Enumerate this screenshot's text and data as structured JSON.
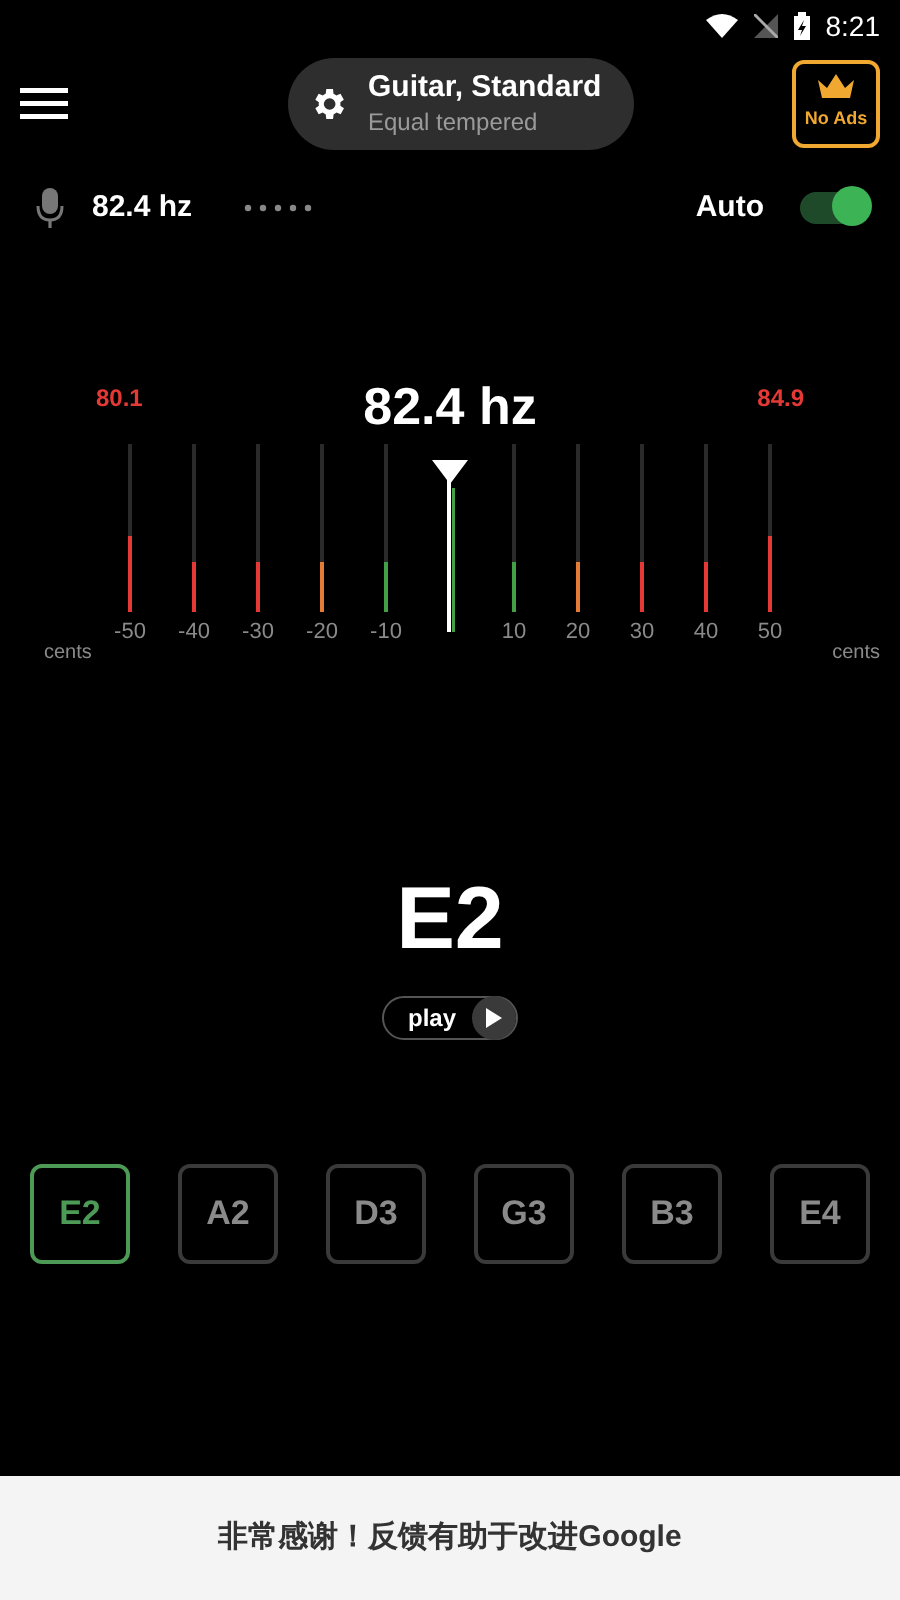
{
  "status_bar": {
    "time": "8:21"
  },
  "header": {
    "tuning_title": "Guitar, Standard",
    "tuning_subtitle": "Equal tempered",
    "no_ads": "No Ads"
  },
  "input": {
    "frequency": "82.4 hz",
    "auto_label": "Auto",
    "auto_on": true
  },
  "meter": {
    "frequency": "82.4 hz",
    "low_reading": "80.1",
    "high_reading": "84.9",
    "unit_left": "cents",
    "unit_right": "cents",
    "ticks_left": [
      {
        "label": "-50",
        "color": "#e53935",
        "level": 0.45
      },
      {
        "label": "-40",
        "color": "#e53935",
        "level": 0.3
      },
      {
        "label": "-30",
        "color": "#e53935",
        "level": 0.3
      },
      {
        "label": "-20",
        "color": "#e57c35",
        "level": 0.3
      },
      {
        "label": "-10",
        "color": "#43a047",
        "level": 0.3
      }
    ],
    "ticks_right": [
      {
        "label": "10",
        "color": "#43a047",
        "level": 0.3
      },
      {
        "label": "20",
        "color": "#e57c35",
        "level": 0.3
      },
      {
        "label": "30",
        "color": "#e53935",
        "level": 0.3
      },
      {
        "label": "40",
        "color": "#e53935",
        "level": 0.3
      },
      {
        "label": "50",
        "color": "#e53935",
        "level": 0.45
      }
    ]
  },
  "note": {
    "name": "E2",
    "play_label": "play"
  },
  "strings": [
    {
      "label": "E2",
      "selected": true
    },
    {
      "label": "A2",
      "selected": false
    },
    {
      "label": "D3",
      "selected": false
    },
    {
      "label": "G3",
      "selected": false
    },
    {
      "label": "B3",
      "selected": false
    },
    {
      "label": "E4",
      "selected": false
    }
  ],
  "banner": {
    "text": "非常感谢！反馈有助于改进Google"
  }
}
